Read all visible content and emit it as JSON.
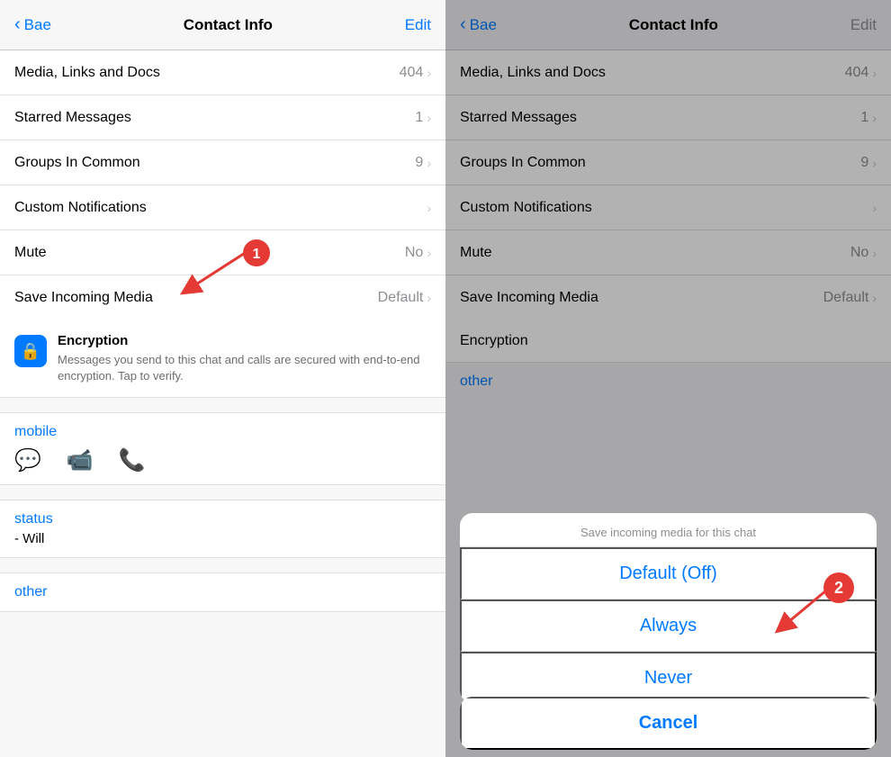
{
  "left": {
    "header": {
      "back_label": "Bae",
      "title": "Contact Info",
      "edit_label": "Edit"
    },
    "rows": [
      {
        "label": "Media, Links and Docs",
        "value": "404",
        "has_chevron": true
      },
      {
        "label": "Starred Messages",
        "value": "1",
        "has_chevron": true
      },
      {
        "label": "Groups In Common",
        "value": "9",
        "has_chevron": true
      },
      {
        "label": "Custom Notifications",
        "value": "",
        "has_chevron": true
      },
      {
        "label": "Mute",
        "value": "No",
        "has_chevron": true
      },
      {
        "label": "Save Incoming Media",
        "value": "Default",
        "has_chevron": true
      }
    ],
    "encryption": {
      "title": "Encryption",
      "body": "Messages you send to this chat and calls are secured with end-to-end encryption. Tap to verify."
    },
    "contact": {
      "label": "mobile"
    },
    "status": {
      "label": "status",
      "value": "- Will"
    },
    "other": {
      "label": "other"
    }
  },
  "right": {
    "header": {
      "back_label": "Bae",
      "title": "Contact Info",
      "edit_label": "Edit"
    },
    "rows": [
      {
        "label": "Media, Links and Docs",
        "value": "404",
        "has_chevron": true
      },
      {
        "label": "Starred Messages",
        "value": "1",
        "has_chevron": true
      },
      {
        "label": "Groups In Common",
        "value": "9",
        "has_chevron": true
      },
      {
        "label": "Custom Notifications",
        "value": "",
        "has_chevron": true
      },
      {
        "label": "Mute",
        "value": "No",
        "has_chevron": true
      },
      {
        "label": "Save Incoming Media",
        "value": "Default",
        "has_chevron": true
      }
    ],
    "encryption": {
      "title": "Encryption"
    },
    "other": {
      "label": "other"
    },
    "action_sheet": {
      "title": "Save incoming media for this chat",
      "options": [
        "Default (Off)",
        "Always",
        "Never"
      ]
    },
    "cancel_label": "Cancel"
  }
}
